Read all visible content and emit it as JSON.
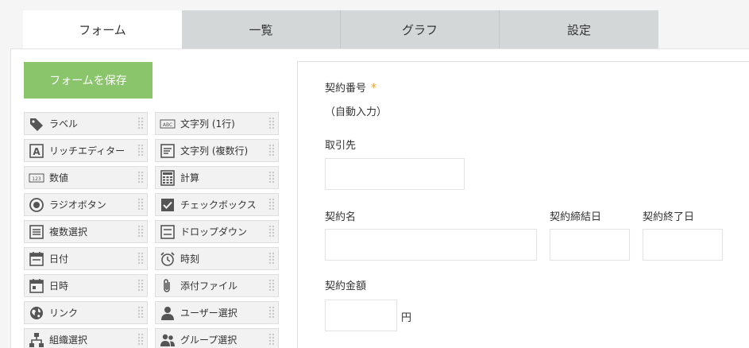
{
  "tabs": [
    {
      "label": "フォーム",
      "active": true
    },
    {
      "label": "一覧",
      "active": false
    },
    {
      "label": "グラフ",
      "active": false
    },
    {
      "label": "設定",
      "active": false
    }
  ],
  "save_button": "フォームを保存",
  "palette": [
    {
      "label": "ラベル",
      "icon": "tag-icon"
    },
    {
      "label": "文字列 (1行)",
      "icon": "abc-text-icon"
    },
    {
      "label": "リッチエディター",
      "icon": "rich-editor-icon"
    },
    {
      "label": "文字列 (複数行)",
      "icon": "multiline-text-icon"
    },
    {
      "label": "数値",
      "icon": "number-icon"
    },
    {
      "label": "計算",
      "icon": "calculator-icon"
    },
    {
      "label": "ラジオボタン",
      "icon": "radio-icon"
    },
    {
      "label": "チェックボックス",
      "icon": "checkbox-icon"
    },
    {
      "label": "複数選択",
      "icon": "multi-select-icon"
    },
    {
      "label": "ドロップダウン",
      "icon": "dropdown-icon"
    },
    {
      "label": "日付",
      "icon": "calendar-icon"
    },
    {
      "label": "時刻",
      "icon": "alarm-clock-icon"
    },
    {
      "label": "日時",
      "icon": "calendar-time-icon"
    },
    {
      "label": "添付ファイル",
      "icon": "paperclip-icon"
    },
    {
      "label": "リンク",
      "icon": "globe-icon"
    },
    {
      "label": "ユーザー選択",
      "icon": "user-icon"
    },
    {
      "label": "組織選択",
      "icon": "organization-icon"
    },
    {
      "label": "グループ選択",
      "icon": "group-icon"
    }
  ],
  "form": {
    "contract_no_label": "契約番号",
    "required_mark": "*",
    "contract_no_value": "（自動入力）",
    "client_label": "取引先",
    "contract_name_label": "契約名",
    "contract_date_label": "契約締結日",
    "contract_end_label": "契約終了日",
    "amount_label": "契約金額",
    "amount_unit": "円"
  },
  "colors": {
    "save_button": "#8ac56c",
    "required": "#e5a03a",
    "tab_inactive": "#d4d7d8"
  }
}
